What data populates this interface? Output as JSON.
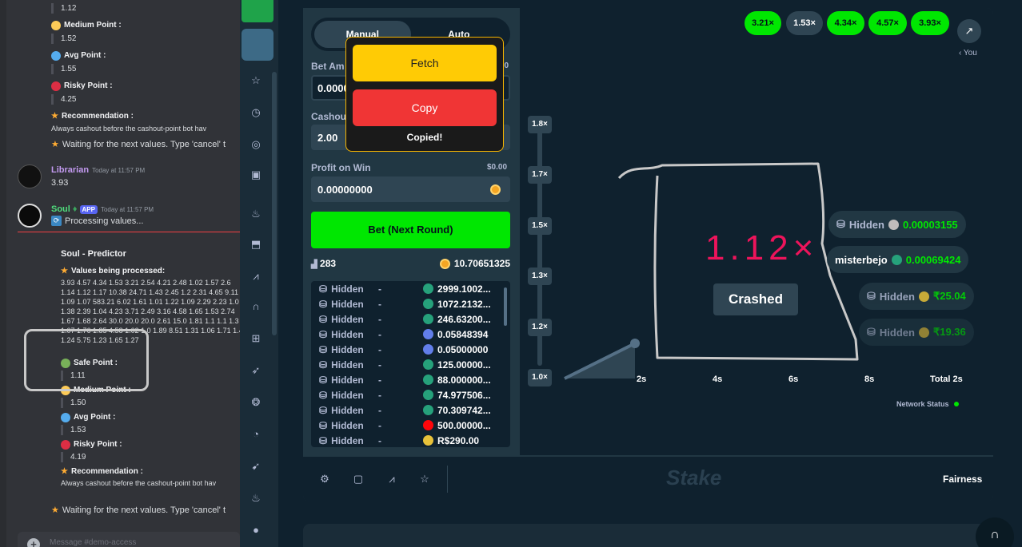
{
  "discord": {
    "top_values": {
      "safe_value": "1.12",
      "medium_label": "Medium Point :",
      "medium_value": "1.52",
      "avg_label": "Avg Point :",
      "avg_value": "1.55",
      "risky_label": "Risky Point :",
      "risky_value": "4.25",
      "rec_label": "Recommendation :",
      "rec_text": "Always cashout before the cashout-point bot hav"
    },
    "waiting_text": "Waiting for the next values. Type 'cancel' t",
    "librarian": {
      "name": "Librarian",
      "time": "Today at 11:57 PM",
      "message": "3.93"
    },
    "soul": {
      "name": "Soul",
      "badge": "APP",
      "time": "Today at 11:57 PM",
      "message": "Processing values..."
    },
    "predictor_title": "Soul - Predictor",
    "values_label": "Values being processed:",
    "values_lines": [
      "3.93 4.57 4.34 1.53 3.21 2.54 4.21 2.48 1.02 1.57 2.6",
      "1.14 1.12 1.17 10.38 24.71 1.43 2.45 1.2 2.31 4.65 9.11 1",
      "1.09 1.07 583.21 6.02 1.61 1.01 1.22 1.09 2.29 2.23 1.0",
      "1.38 2.39 1.04 4.23 3.71 2.49 3.16 4.58 1.65 1.53 2.74",
      "1.67 1.68 2.64 30.0 20.0 20.0 2.61 15.0 1.81 1.1 1.1 1.3",
      "1.07 1.76 1.85 4.58 1.02 1.0 1.89 8.51 1.31 1.06 1.71 1.4",
      "1.24 5.75 1.23 1.65 1.27"
    ],
    "bottom_values": {
      "safe_label": "Safe Point :",
      "safe_value": "1.11",
      "medium_label": "Medium Point :",
      "avg_label": "Avg Point :",
      "avg_value": "1.53",
      "risky_label": "Risky Point :",
      "risky_value": "4.19",
      "rec_label": "Recommendation :",
      "rec_text": "Always cashout before the cashout-point bot hav",
      "medium_value": "1.50"
    },
    "message_placeholder": "Message #demo-access"
  },
  "game": {
    "tabs": [
      "Manual",
      "Auto"
    ],
    "bet_amount_label": "Bet Am",
    "bet_amount_right": "00",
    "bet_amount_value": "0.0000",
    "cashout_label": "Cashou",
    "cashout_value": "2.00",
    "profit_label": "Profit on Win",
    "profit_right": "$0.00",
    "profit_value": "0.00000000",
    "bet_button": "Bet (Next Round)",
    "player_count": "283",
    "total_amount": "10.70651325",
    "players": [
      {
        "name": "Hidden",
        "dash": "-",
        "amount": "2999.1002...",
        "token": "#26a17b"
      },
      {
        "name": "Hidden",
        "dash": "-",
        "amount": "1072.2132...",
        "token": "#26a17b"
      },
      {
        "name": "Hidden",
        "dash": "-",
        "amount": "246.63200...",
        "token": "#26a17b"
      },
      {
        "name": "Hidden",
        "dash": "-",
        "amount": "0.05848394",
        "token": "#627eea"
      },
      {
        "name": "Hidden",
        "dash": "-",
        "amount": "0.05000000",
        "token": "#627eea"
      },
      {
        "name": "Hidden",
        "dash": "-",
        "amount": "125.00000...",
        "token": "#26a17b"
      },
      {
        "name": "Hidden",
        "dash": "-",
        "amount": "88.000000...",
        "token": "#26a17b"
      },
      {
        "name": "Hidden",
        "dash": "-",
        "amount": "74.977506...",
        "token": "#26a17b"
      },
      {
        "name": "Hidden",
        "dash": "-",
        "amount": "70.309742...",
        "token": "#26a17b"
      },
      {
        "name": "Hidden",
        "dash": "-",
        "amount": "500.00000...",
        "token": "#ff060a"
      },
      {
        "name": "Hidden",
        "dash": "-",
        "amount": "R$290.00",
        "token": "#e8c23a"
      }
    ],
    "popup": {
      "fetch": "Fetch",
      "copy": "Copy",
      "status": "Copied!"
    },
    "history": [
      "3.21×",
      "1.53×",
      "4.34×",
      "4.57×",
      "3.93×"
    ],
    "you_label": "‹ You",
    "y_ticks": [
      "1.8×",
      "1.7×",
      "1.5×",
      "1.3×",
      "1.2×",
      "1.0×"
    ],
    "x_ticks": [
      "2s",
      "4s",
      "6s",
      "8s",
      "Total 2s"
    ],
    "network_status": "Network Status",
    "multiplier": "1.12×",
    "crashed": "Crashed",
    "cashouts": [
      {
        "name": "Hidden",
        "amount": "0.00003155",
        "token": "#bfbbbb"
      },
      {
        "name": "misterbejo",
        "amount": "0.00069424",
        "token": "#26a17b"
      },
      {
        "name": "Hidden",
        "amount": "₹25.04",
        "token": "#e8c23a"
      },
      {
        "name": "Hidden",
        "amount": "₹19.36",
        "token": "#e8c23a"
      }
    ],
    "logo": "Stake",
    "fairness": "Fairness"
  },
  "colors": {
    "accent_green": "#00e701",
    "crash_red": "#ed145b",
    "popup_border": "#f5b400"
  }
}
